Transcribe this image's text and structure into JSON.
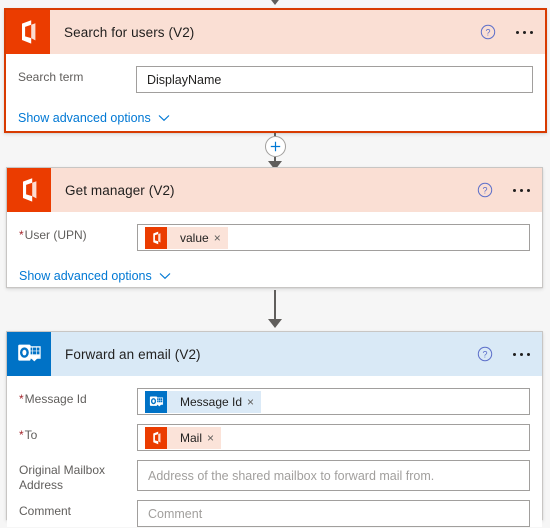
{
  "flow": {
    "cards": [
      {
        "id": "search-for-users",
        "title": "Search for users (V2)",
        "connector_app": "office365-users",
        "selected": true,
        "help_icon": "help-circle-icon",
        "menu_icon": "ellipsis-icon",
        "fields": [
          {
            "label": "Search term",
            "required": false,
            "value": "DisplayName",
            "placeholder": "",
            "type": "text"
          }
        ],
        "advanced_link": "Show advanced options",
        "advanced_chevron": "chevron-down-icon"
      },
      {
        "id": "get-manager",
        "title": "Get manager (V2)",
        "connector_app": "office365-users",
        "selected": false,
        "help_icon": "help-circle-icon",
        "menu_icon": "ellipsis-icon",
        "fields": [
          {
            "label": "User (UPN)",
            "required": true,
            "type": "token",
            "token": {
              "label": "value",
              "app": "office365-users",
              "remove": "×"
            }
          }
        ],
        "advanced_link": "Show advanced options",
        "advanced_chevron": "chevron-down-icon"
      },
      {
        "id": "forward-an-email",
        "title": "Forward an email (V2)",
        "connector_app": "office365-outlook",
        "selected": false,
        "help_icon": "help-circle-icon",
        "menu_icon": "ellipsis-icon",
        "fields": [
          {
            "label": "Message Id",
            "required": true,
            "type": "token",
            "token": {
              "label": "Message Id",
              "app": "office365-outlook",
              "remove": "×"
            }
          },
          {
            "label": "To",
            "required": true,
            "type": "token",
            "token": {
              "label": "Mail",
              "app": "office365-users",
              "remove": "×"
            }
          },
          {
            "label": "Original Mailbox Address",
            "required": false,
            "type": "text",
            "value": "",
            "placeholder": "Address of the shared mailbox to forward mail from."
          },
          {
            "label": "Comment",
            "required": false,
            "type": "text",
            "value": "",
            "placeholder": "Comment"
          }
        ]
      }
    ],
    "connectors": [
      {
        "id": "conn-top",
        "has_plus": false,
        "icon": "arrow-down-icon"
      },
      {
        "id": "conn-1-2",
        "has_plus": true,
        "plus_icon": "plus-icon",
        "icon": "arrow-down-icon"
      },
      {
        "id": "conn-2-3",
        "has_plus": false,
        "icon": "arrow-down-icon"
      }
    ],
    "colors": {
      "o365_orange": "#eb3c00",
      "outlook_blue": "#0072c6",
      "selected_border": "#d83b01",
      "link_blue": "#0078d4",
      "required_red": "#a4262c",
      "canvas_bg": "#f6f6f6"
    },
    "required_marker": "*"
  }
}
